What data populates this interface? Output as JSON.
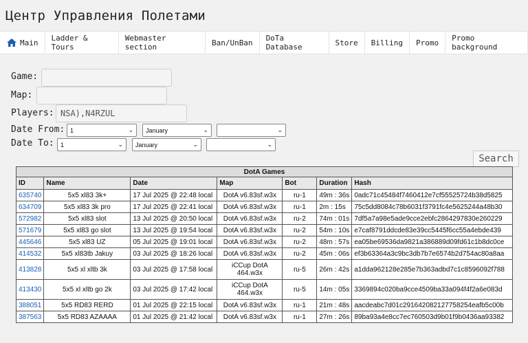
{
  "app": {
    "title": "Центр Управления Полетами"
  },
  "nav": {
    "items": [
      {
        "label": "Main",
        "icon": "home-icon"
      },
      {
        "label": "Ladder & Tours"
      },
      {
        "label": "Webmaster section"
      },
      {
        "label": "Ban/UnBan"
      },
      {
        "label": "DoTa Database"
      },
      {
        "label": "Store"
      },
      {
        "label": "Billing"
      },
      {
        "label": "Promo"
      },
      {
        "label": "Promo background"
      }
    ]
  },
  "filters": {
    "game_label": "Game:",
    "game_value": "",
    "map_label": "Map:",
    "map_value": "",
    "players_label": "Players:",
    "players_value": "NSA),N4RZUL",
    "date_from_label": "Date From:",
    "date_to_label": "Date To:",
    "from_day": "1",
    "from_month": "January",
    "from_year": "",
    "to_day": "1",
    "to_month": "January",
    "to_year": "",
    "search_label": "Search"
  },
  "table": {
    "caption": "DotA Games",
    "columns": [
      "ID",
      "Name",
      "Date",
      "Map",
      "Bot",
      "Duration",
      "Hash"
    ],
    "rows": [
      {
        "id": "635740",
        "name": "5x5 xl83 3k+",
        "date": "17 Jul 2025 @ 22:48 local",
        "map": "DotA v6.83sf.w3x",
        "bot": "ru-1",
        "duration": "49m : 36s",
        "hash": "0adc71c45484f7460412e7cf55525724b38d5825"
      },
      {
        "id": "634709",
        "name": "5x5 xl83 3k pro",
        "date": "17 Jul 2025 @ 22:41 local",
        "map": "DotA v6.83sf.w3x",
        "bot": "ru-1",
        "duration": "2m : 15s",
        "hash": "75c5dd8084c78b6031f3791fc4e5625244a48b30"
      },
      {
        "id": "572982",
        "name": "5x5 xl83 slot",
        "date": "13 Jul 2025 @ 20:50 local",
        "map": "DotA v6.83sf.w3x",
        "bot": "ru-2",
        "duration": "74m : 01s",
        "hash": "7df5a7a98e5ade9cce2ebfc2864297830e260229"
      },
      {
        "id": "571679",
        "name": "5x5 xl83 go slot",
        "date": "13 Jul 2025 @ 19:54 local",
        "map": "DotA v6.83sf.w3x",
        "bot": "ru-2",
        "duration": "54m : 10s",
        "hash": "e7caf8791ddcde83e39cc5445f6cc55a4ebde439"
      },
      {
        "id": "445646",
        "name": "5x5 xl83 UZ",
        "date": "05 Jul 2025 @ 19:01 local",
        "map": "DotA v6.83sf.w3x",
        "bot": "ru-2",
        "duration": "48m : 57s",
        "hash": "ea05be69536da9821a386889d09fd61c1b8dc0ce"
      },
      {
        "id": "414532",
        "name": "5x5 xl83tb Jakuy",
        "date": "03 Jul 2025 @ 18:26 local",
        "map": "DotA v6.83sf.w3x",
        "bot": "ru-2",
        "duration": "45m : 06s",
        "hash": "ef3b63364a3c9bc3db7b7e6574b2d754ac80a8aa"
      },
      {
        "id": "413828",
        "name": "5x5 xl xltb 3k",
        "date": "03 Jul 2025 @ 17:58 local",
        "map": "iCCup DotA 464.w3x",
        "bot": "ru-5",
        "duration": "26m : 42s",
        "hash": "a1dda962128e285e7b363adbd7c1c8596092f788",
        "tall": true
      },
      {
        "id": "413430",
        "name": "5x5 xl xltb go 2k",
        "date": "03 Jul 2025 @ 17:42 local",
        "map": "iCCup DotA 464.w3x",
        "bot": "ru-5",
        "duration": "14m : 05s",
        "hash": "3369894c020ba9cce4509ba33a094f4f2a6e083d",
        "tall": true
      },
      {
        "id": "388051",
        "name": "5x5 RD83 RERD",
        "date": "01 Jul 2025 @ 22:15 local",
        "map": "DotA v6.83sf.w3x",
        "bot": "ru-1",
        "duration": "21m : 48s",
        "hash": "aacdeabc7d01c291642082127758254eafb5c00b"
      },
      {
        "id": "387563",
        "name": "5x5 RD83 AZAAAA",
        "date": "01 Jul 2025 @ 21:42 local",
        "map": "DotA v6.83sf.w3x",
        "bot": "ru-1",
        "duration": "27m : 26s",
        "hash": "89ba93a4e8cc7ec760503d9b01f9b0436aa93382"
      }
    ]
  }
}
